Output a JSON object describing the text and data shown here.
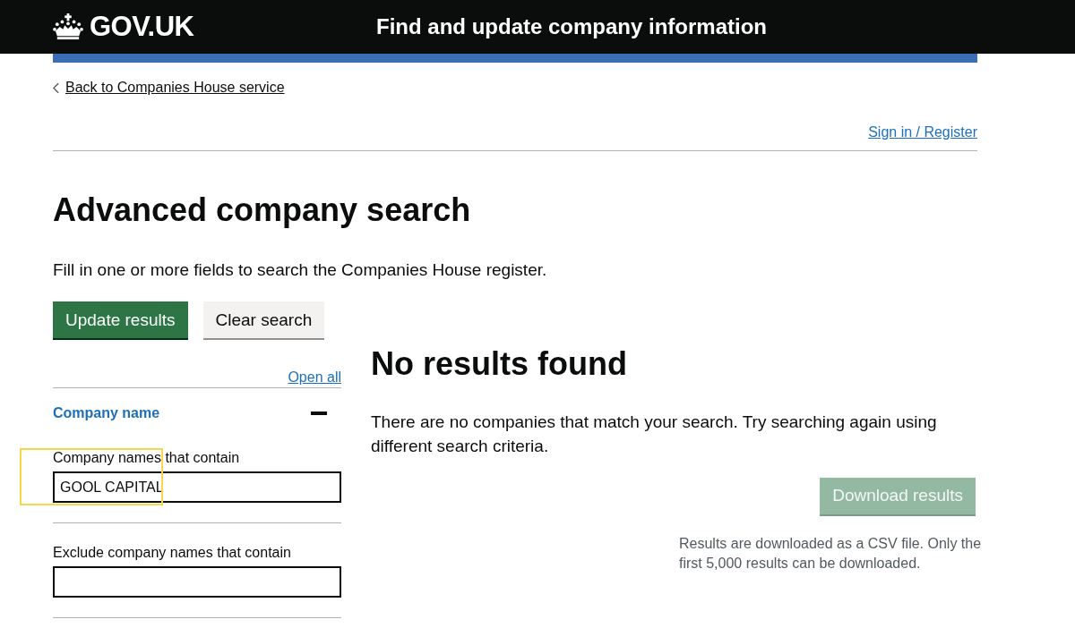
{
  "header": {
    "logo_text": "GOV.UK",
    "service_name": "Find and update company information"
  },
  "back_link": "Back to Companies House service",
  "sign_in_link": "Sign in / Register",
  "heading": "Advanced company search",
  "intro": "Fill in one or more fields to search the Companies House register.",
  "buttons": [
    {
      "label": "Update results",
      "kind": "primary"
    },
    {
      "label": "Clear search",
      "kind": "secondary"
    }
  ],
  "filters": {
    "open_all": "Open all",
    "sections": [
      {
        "title": "Company name",
        "expanded": true,
        "fields": [
          {
            "label": "Company names that contain",
            "value": "GOOL CAPITAL",
            "highlighted": true
          },
          {
            "label": "Exclude company names that contain",
            "highlighted": false
          }
        ]
      }
    ]
  },
  "results": {
    "heading": "No results found",
    "message": "There are no companies that match your search. Try searching again using different search criteria.",
    "download_button": {
      "label": "Download results",
      "disabled": true
    },
    "note": "Results are downloaded as a CSV file. Only the first 5,000 results can be downloaded."
  }
}
